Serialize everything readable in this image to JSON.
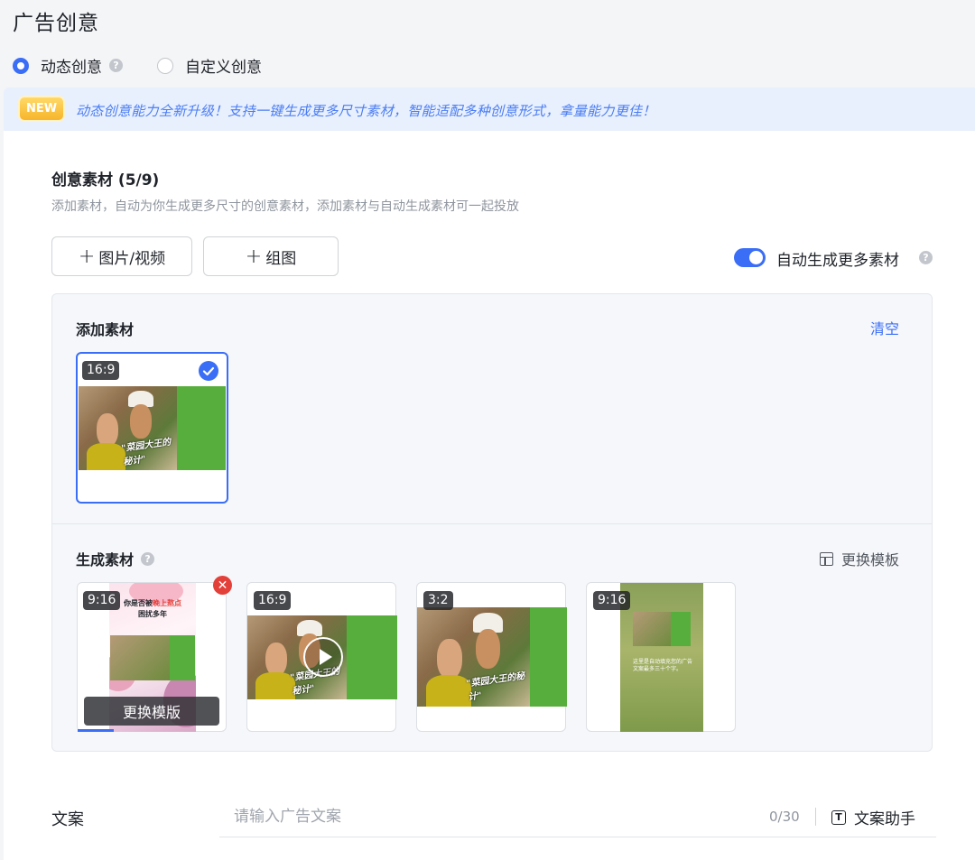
{
  "page": {
    "title": "广告创意"
  },
  "creative_type": {
    "options": [
      {
        "label": "动态创意",
        "checked": true
      },
      {
        "label": "自定义创意",
        "checked": false
      }
    ]
  },
  "notice": {
    "badge": "NEW",
    "text": "动态创意能力全新升级！支持一键生成更多尺寸素材，智能适配多种创意形式，拿量能力更佳！"
  },
  "materials": {
    "title": "创意素材 (5/9)",
    "description": "添加素材，自动为你生成更多尺寸的创意素材，添加素材与自动生成素材可一起投放",
    "add_media_button": "图片/视频",
    "add_group_button": "组图",
    "auto_generate_label": "自动生成更多素材",
    "auto_generate_enabled": true
  },
  "added": {
    "title": "添加素材",
    "clear_label": "清空",
    "items": [
      {
        "ratio": "16:9",
        "selected": true,
        "caption": "\"菜园大王的秘计\""
      }
    ]
  },
  "generated": {
    "title": "生成素材",
    "change_template_label": "更换模板",
    "items": [
      {
        "ratio": "9:16",
        "overlay": "更换模版",
        "headline_part1": "你是否被",
        "headline_highlight": "晚上熬点",
        "headline_part2": "困扰多年"
      },
      {
        "ratio": "16:9",
        "caption": "\"菜园大王的秘计\""
      },
      {
        "ratio": "3:2",
        "caption": "\"菜园大王的秘计\""
      },
      {
        "ratio": "9:16",
        "body_text": "这里是自动填充您的广告文案最多三十个字。"
      }
    ]
  },
  "copy": {
    "label": "文案",
    "placeholder": "请输入广告文案",
    "counter": "0/30",
    "assistant_label": "文案助手"
  },
  "colors": {
    "accent": "#3b6ef6",
    "brand_green": "#58ae3c",
    "danger": "#e3403a"
  }
}
